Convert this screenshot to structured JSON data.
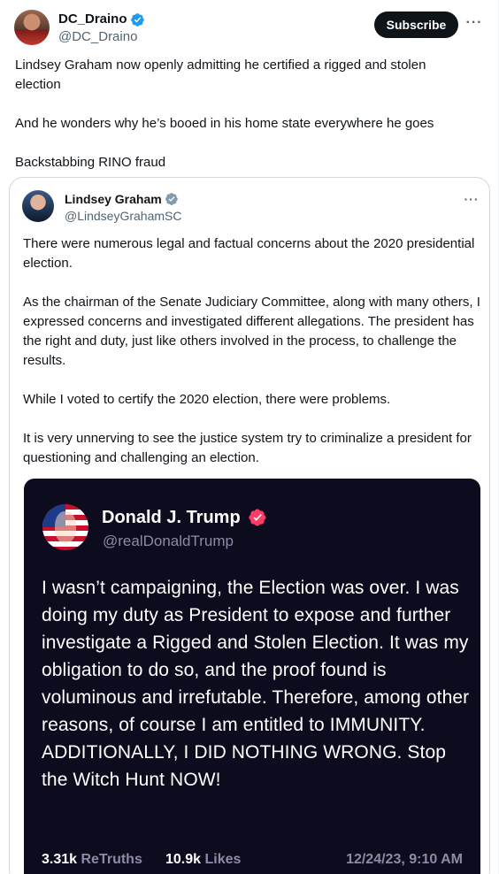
{
  "post": {
    "author": {
      "name": "DC_Draino",
      "handle": "@DC_Draino",
      "verified_color": "#1d9bf0"
    },
    "subscribe_label": "Subscribe",
    "more_label": "···",
    "paragraphs": [
      "Lindsey Graham now openly admitting he certified a rigged and stolen election",
      "And he wonders why he’s booed in his home state everywhere he goes",
      "Backstabbing RINO fraud"
    ]
  },
  "quote": {
    "author": {
      "name": "Lindsey Graham",
      "handle": "@LindseyGrahamSC",
      "badge_color": "#829aab"
    },
    "more_label": "···",
    "paragraphs": [
      "There were numerous legal and factual concerns about the 2020 presidential election.",
      "As the chairman of the Senate Judiciary Committee, along with many others, I expressed concerns and investigated different allegations. The president has the right and duty, just like others involved in the process, to challenge the results.",
      "While I voted to certify the 2020 election, there were problems.",
      "It is very unnerving to see the justice system try to criminalize a president for questioning and challenging an election."
    ]
  },
  "embed": {
    "background": "#0d0b1e",
    "author": {
      "name": "Donald J. Trump",
      "handle": "@realDonaldTrump",
      "verified_color": "#ff3c64"
    },
    "body": "I wasn’t campaigning, the Election was over. I was doing my duty as President to expose and further investigate a Rigged and Stolen Election. It was my obligation to do so, and the proof found is voluminous and irrefutable. Therefore, among other reasons, of course I am entitled to IMMUNITY. ADDITIONALLY, I DID NOTHING WRONG. Stop the Witch Hunt NOW!",
    "stats": {
      "retruths_count": "3.31k",
      "retruths_label": "ReTruths",
      "likes_count": "10.9k",
      "likes_label": "Likes",
      "date": "12/24/23, 9:10 AM"
    }
  }
}
